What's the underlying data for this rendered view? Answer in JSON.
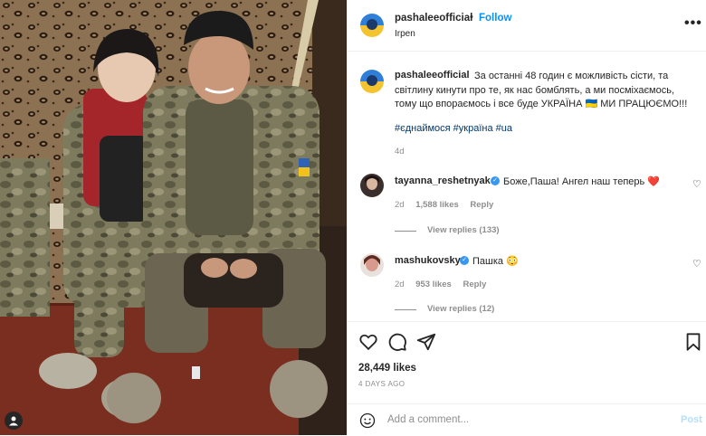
{
  "post": {
    "username": "pashaleeofficial",
    "separator": "•",
    "follow_label": "Follow",
    "location": "Irpen",
    "more_label": "•••",
    "more_icon": "more-horizontal-icon"
  },
  "caption": {
    "username": "pashaleeofficial",
    "text": "За останні 48 годин є можливість сісти, та світлину кинути про те, як нас бомблять, а ми посміхаємось, тому що впораємось і все буде УКРАЇНА 🇺🇦 МИ ПРАЦЮЄМО!!!",
    "hashtags": "#єднаймося #україна #ua",
    "time": "4d"
  },
  "comments": [
    {
      "username": "tayanna_reshetnyak",
      "verified": true,
      "text": "Боже,Паша! Ангел наш теперь ❤️",
      "time": "2d",
      "likes": "1,588 likes",
      "reply_label": "Reply",
      "view_replies": "View replies (133)"
    },
    {
      "username": "mashukovsky",
      "verified": true,
      "text": "Пашка 😳",
      "time": "2d",
      "likes": "953 likes",
      "reply_label": "Reply",
      "view_replies": "View replies (12)"
    }
  ],
  "actions": {
    "icons": [
      "heart-icon",
      "comment-icon",
      "share-icon",
      "bookmark-icon"
    ],
    "likes": "28,449 likes",
    "posted_ago": "4 DAYS AGO"
  },
  "add_comment": {
    "placeholder": "Add a comment...",
    "post_label": "Post",
    "emoji_icon": "emoji-icon"
  },
  "colors": {
    "link_blue": "#0095f6",
    "hashtag_blue": "#00376b",
    "muted": "#8e8e8e",
    "post_disabled": "#b2dffc",
    "verified": "#3897f0"
  }
}
